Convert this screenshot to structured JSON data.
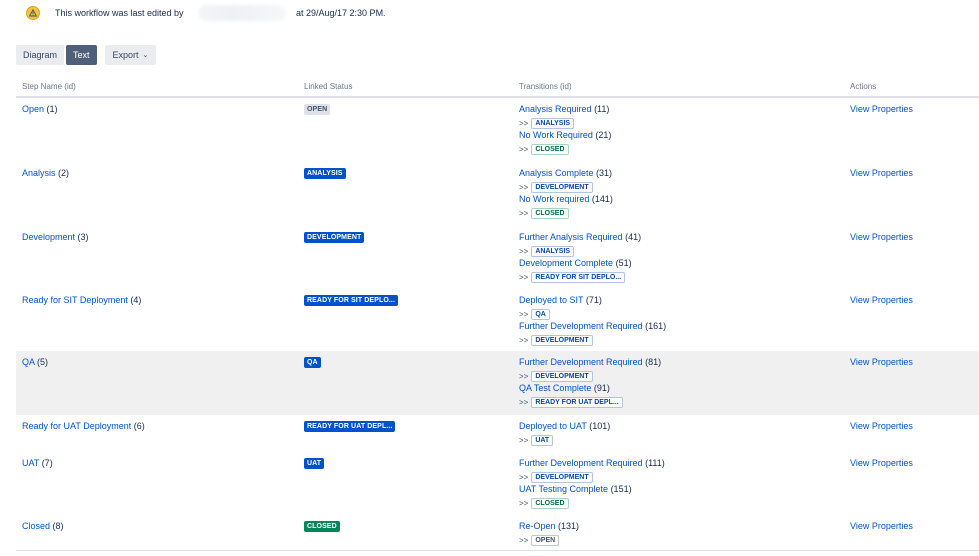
{
  "banner": {
    "icon": "warning-icon",
    "text_before": "This workflow was last edited by",
    "text_after": "at 29/Aug/17 2:30 PM."
  },
  "toolbar": {
    "diagram_label": "Diagram",
    "text_label": "Text",
    "export_label": "Export"
  },
  "table": {
    "headers": {
      "step": "Step Name (id)",
      "status": "Linked Status",
      "transitions": "Transitions (id)",
      "actions": "Actions"
    },
    "action_label": "View Properties",
    "arrow": ">>",
    "rows": [
      {
        "name": "Open",
        "id": "(1)",
        "status": "OPEN",
        "status_color": "gray",
        "transitions": [
          {
            "name": "Analysis Required",
            "id": "(11)",
            "target": "ANALYSIS",
            "target_color": "blue"
          },
          {
            "name": "No Work Required",
            "id": "(21)",
            "target": "CLOSED",
            "target_color": "green"
          }
        ]
      },
      {
        "name": "Analysis",
        "id": "(2)",
        "status": "ANALYSIS",
        "status_color": "blue",
        "transitions": [
          {
            "name": "Analysis Complete",
            "id": "(31)",
            "target": "DEVELOPMENT",
            "target_color": "blue"
          },
          {
            "name": "No Work required",
            "id": "(141)",
            "target": "CLOSED",
            "target_color": "green"
          }
        ]
      },
      {
        "name": "Development",
        "id": "(3)",
        "status": "DEVELOPMENT",
        "status_color": "blue",
        "transitions": [
          {
            "name": "Further Analysis Required",
            "id": "(41)",
            "target": "ANALYSIS",
            "target_color": "blue"
          },
          {
            "name": "Development Complete",
            "id": "(51)",
            "target": "READY FOR SIT DEPLO...",
            "target_color": "blue"
          }
        ]
      },
      {
        "name": "Ready for SIT Deployment",
        "id": "(4)",
        "status": "READY FOR SIT DEPLO...",
        "status_color": "blue",
        "transitions": [
          {
            "name": "Deployed to SIT",
            "id": "(71)",
            "target": "QA",
            "target_color": "blue"
          },
          {
            "name": "Further Development Required",
            "id": "(161)",
            "target": "DEVELOPMENT",
            "target_color": "blue"
          }
        ]
      },
      {
        "name": "QA",
        "id": "(5)",
        "status": "QA",
        "status_color": "blue",
        "highlighted": true,
        "transitions": [
          {
            "name": "Further Development Required",
            "id": "(81)",
            "target": "DEVELOPMENT",
            "target_color": "blue"
          },
          {
            "name": "QA Test Complete",
            "id": "(91)",
            "target": "READY FOR UAT DEPL...",
            "target_color": "blue"
          }
        ]
      },
      {
        "name": "Ready for UAT Deployment",
        "id": "(6)",
        "status": "READY FOR UAT DEPL...",
        "status_color": "blue",
        "transitions": [
          {
            "name": "Deployed to UAT",
            "id": "(101)",
            "target": "UAT",
            "target_color": "blue"
          }
        ]
      },
      {
        "name": "UAT",
        "id": "(7)",
        "status": "UAT",
        "status_color": "blue",
        "transitions": [
          {
            "name": "Further Development Required",
            "id": "(111)",
            "target": "DEVELOPMENT",
            "target_color": "blue"
          },
          {
            "name": "UAT Testing Complete",
            "id": "(151)",
            "target": "CLOSED",
            "target_color": "green"
          }
        ]
      },
      {
        "name": "Closed",
        "id": "(8)",
        "status": "CLOSED",
        "status_color": "green",
        "transitions": [
          {
            "name": "Re-Open",
            "id": "(131)",
            "target": "OPEN",
            "target_color": "gray"
          }
        ]
      }
    ]
  }
}
